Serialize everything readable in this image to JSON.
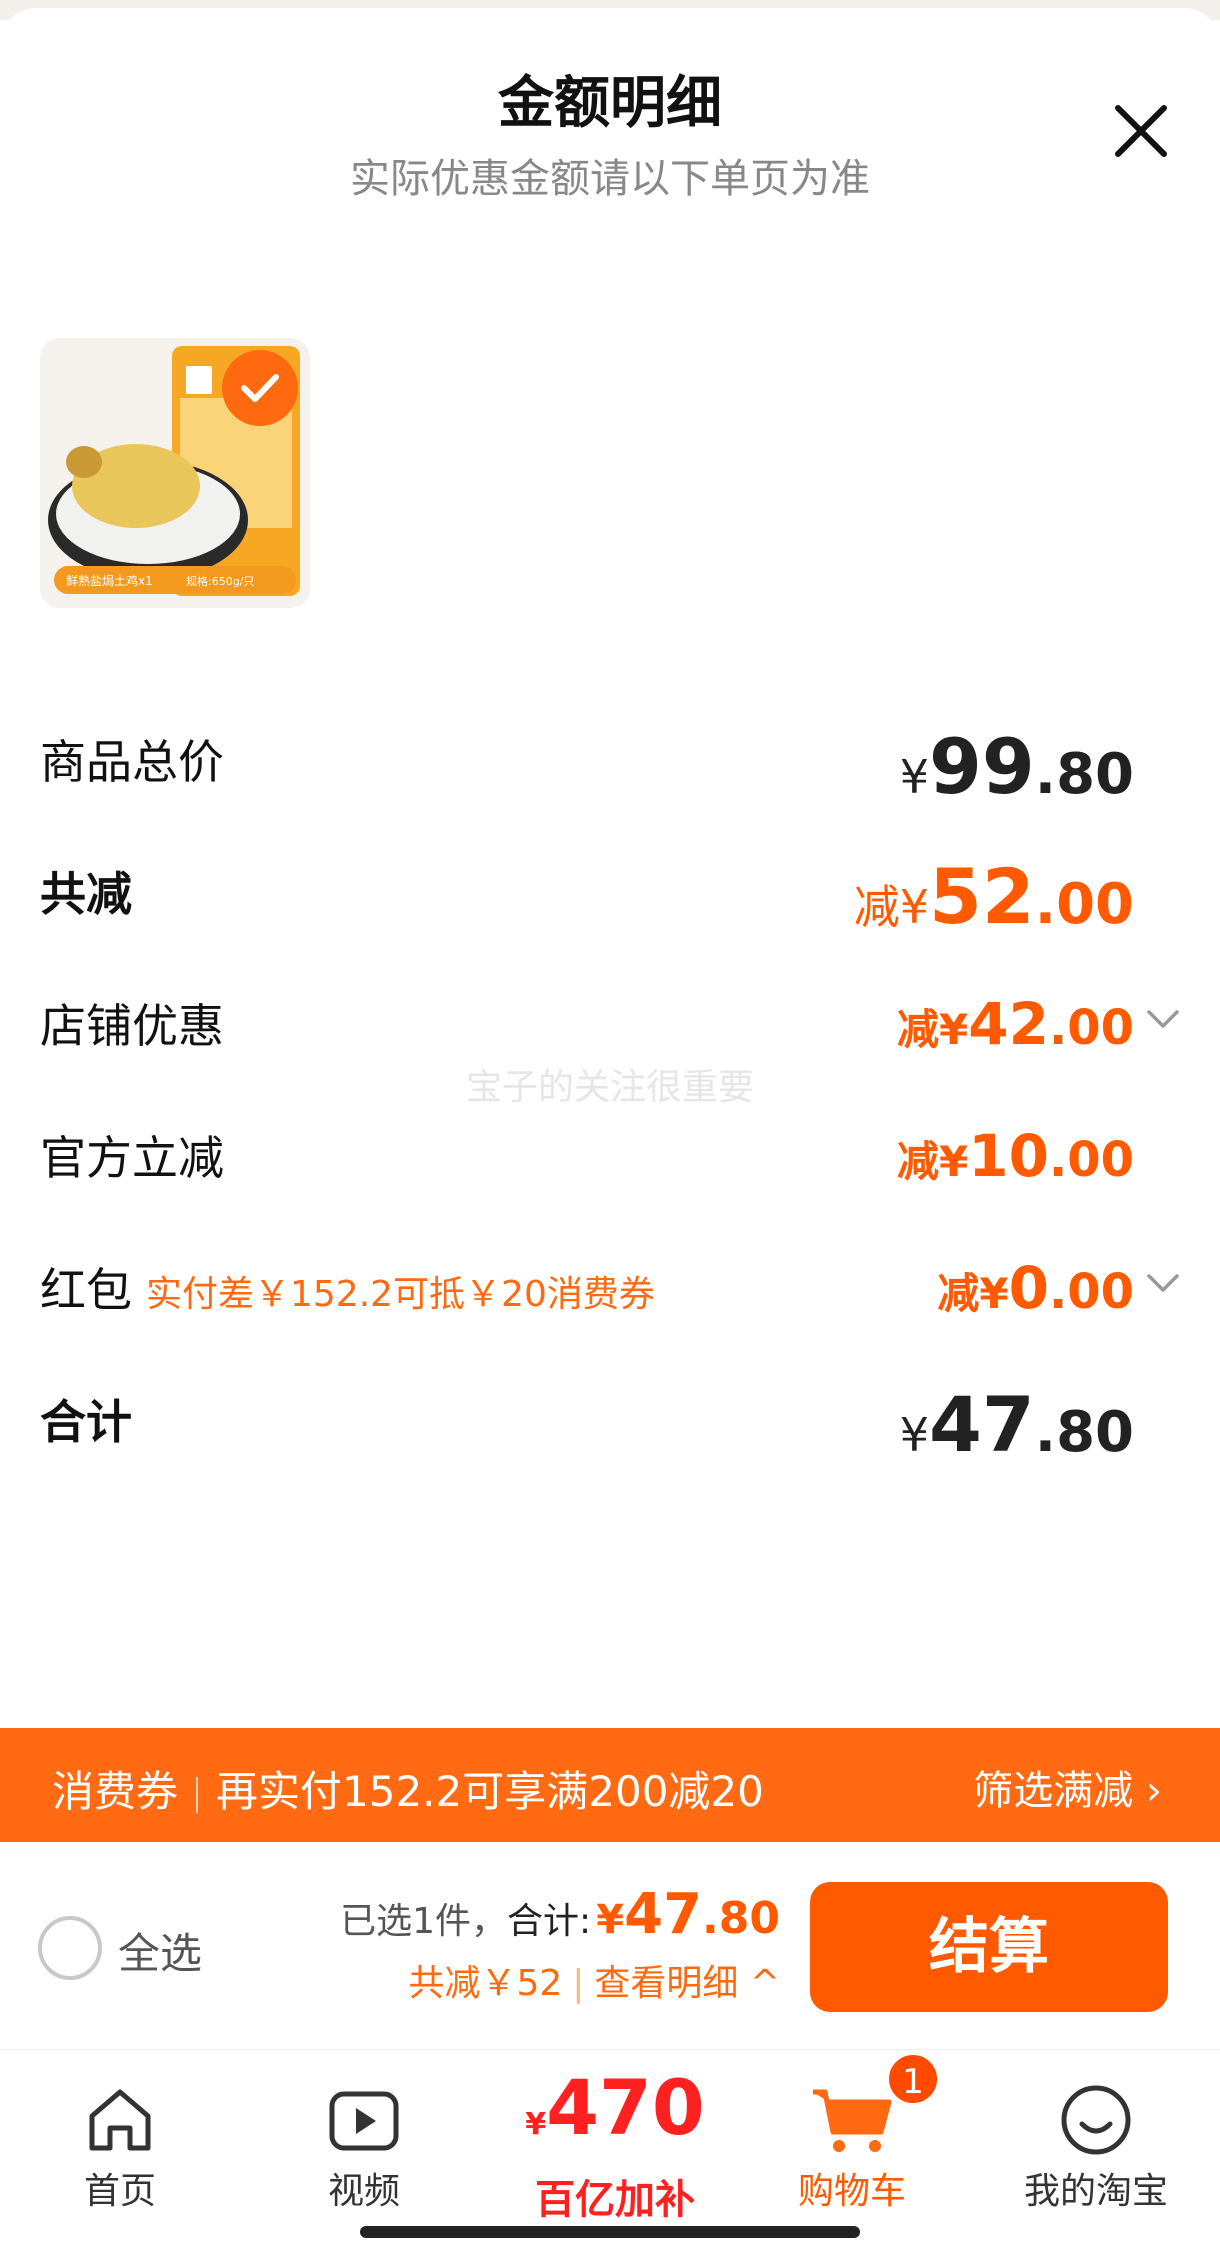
{
  "header": {
    "title": "金额明细",
    "subtitle": "实际优惠金额请以下单页为准",
    "close_icon": "close-icon"
  },
  "product": {
    "bag_text": "鲜熟盐焗土鸡x1",
    "bag_spec": "规格:650g/只",
    "checked": true
  },
  "rows": {
    "total": {
      "label": "商品总价",
      "sym": "¥",
      "int": "99",
      "dec": ".80"
    },
    "discount": {
      "label": "共减",
      "prefix": "减¥",
      "int": "52",
      "dec": ".00"
    },
    "store": {
      "label": "店铺优惠",
      "prefix": "减¥",
      "int": "42",
      "dec": ".00"
    },
    "official": {
      "label": "官方立减",
      "prefix": "减¥",
      "int": "10",
      "dec": ".00"
    },
    "redpacket": {
      "label": "红包",
      "hint": "实付差￥152.2可抵￥20消费券",
      "prefix": "减¥",
      "int": "0",
      "dec": ".00"
    },
    "sum": {
      "label": "合计",
      "sym": "¥",
      "int": "47",
      "dec": ".80"
    }
  },
  "watermark": "宝子的关注很重要",
  "coupon_bar": {
    "tag": "消费券",
    "text": "再实付152.2可享满200减20",
    "action": "筛选满减 ›"
  },
  "checkout": {
    "select_all": "全选",
    "selected": "已选1件，",
    "total_label": "合计:",
    "total_sym": "¥",
    "total_int": "47",
    "total_dec": ".80",
    "saved": "共减￥52",
    "detail": "查看明细 ^",
    "pay": "结算"
  },
  "tabbar": {
    "home": "首页",
    "video": "视频",
    "promo_sym": "¥",
    "promo_num": "470",
    "promo_label": "百亿加补",
    "cart": "购物车",
    "cart_badge": "1",
    "mine": "我的淘宝"
  },
  "colors": {
    "accent": "#ff5a00",
    "bar": "#ff6a12"
  }
}
